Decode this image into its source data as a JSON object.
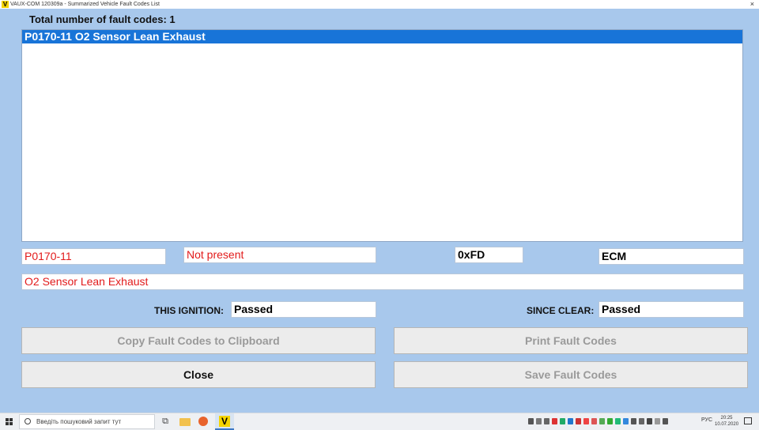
{
  "window": {
    "title": "VAUX-COM 120309a - Summarized Vehicle Fault Codes List",
    "app_icon_letter": "V",
    "close_glyph": "×"
  },
  "summary": {
    "total_label": "Total number of fault codes: 1"
  },
  "fault_list": {
    "items": [
      {
        "text": "P0170-11 O2 Sensor Lean Exhaust",
        "selected": true
      }
    ]
  },
  "details": {
    "code": "P0170-11",
    "status": "Not present",
    "hex": "0xFD",
    "module": "ECM",
    "description": "O2 Sensor Lean Exhaust",
    "this_ignition_label": "THIS IGNITION:",
    "this_ignition_value": "Passed",
    "since_clear_label": "SINCE CLEAR:",
    "since_clear_value": "Passed"
  },
  "buttons": {
    "copy": "Copy Fault Codes to Clipboard",
    "print": "Print Fault Codes",
    "close": "Close",
    "save": "Save Fault Codes"
  },
  "taskbar": {
    "search_placeholder": "Введіть пошуковий запит тут",
    "app_letter": "V",
    "language": "РУС",
    "time": "20:25",
    "date": "10.07.2020"
  },
  "colors": {
    "window_bg": "#a8c8ec",
    "selection": "#1874d8",
    "value_red": "#e21b1b",
    "disabled_text": "#9a9a9a"
  }
}
